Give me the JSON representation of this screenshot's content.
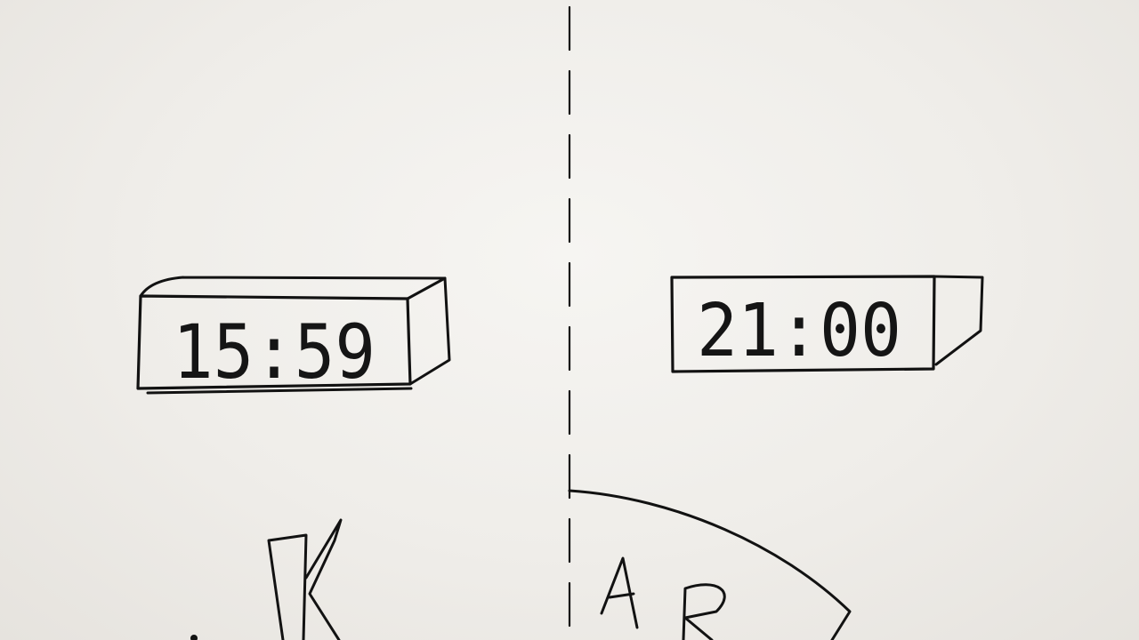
{
  "left_clock": {
    "time": "15:59"
  },
  "right_clock": {
    "time": "21:00"
  },
  "bottom_letters": {
    "left": "K",
    "right_a": "A",
    "right_b": "R"
  },
  "colors": {
    "paper": "#efede9",
    "ink": "#121212"
  }
}
